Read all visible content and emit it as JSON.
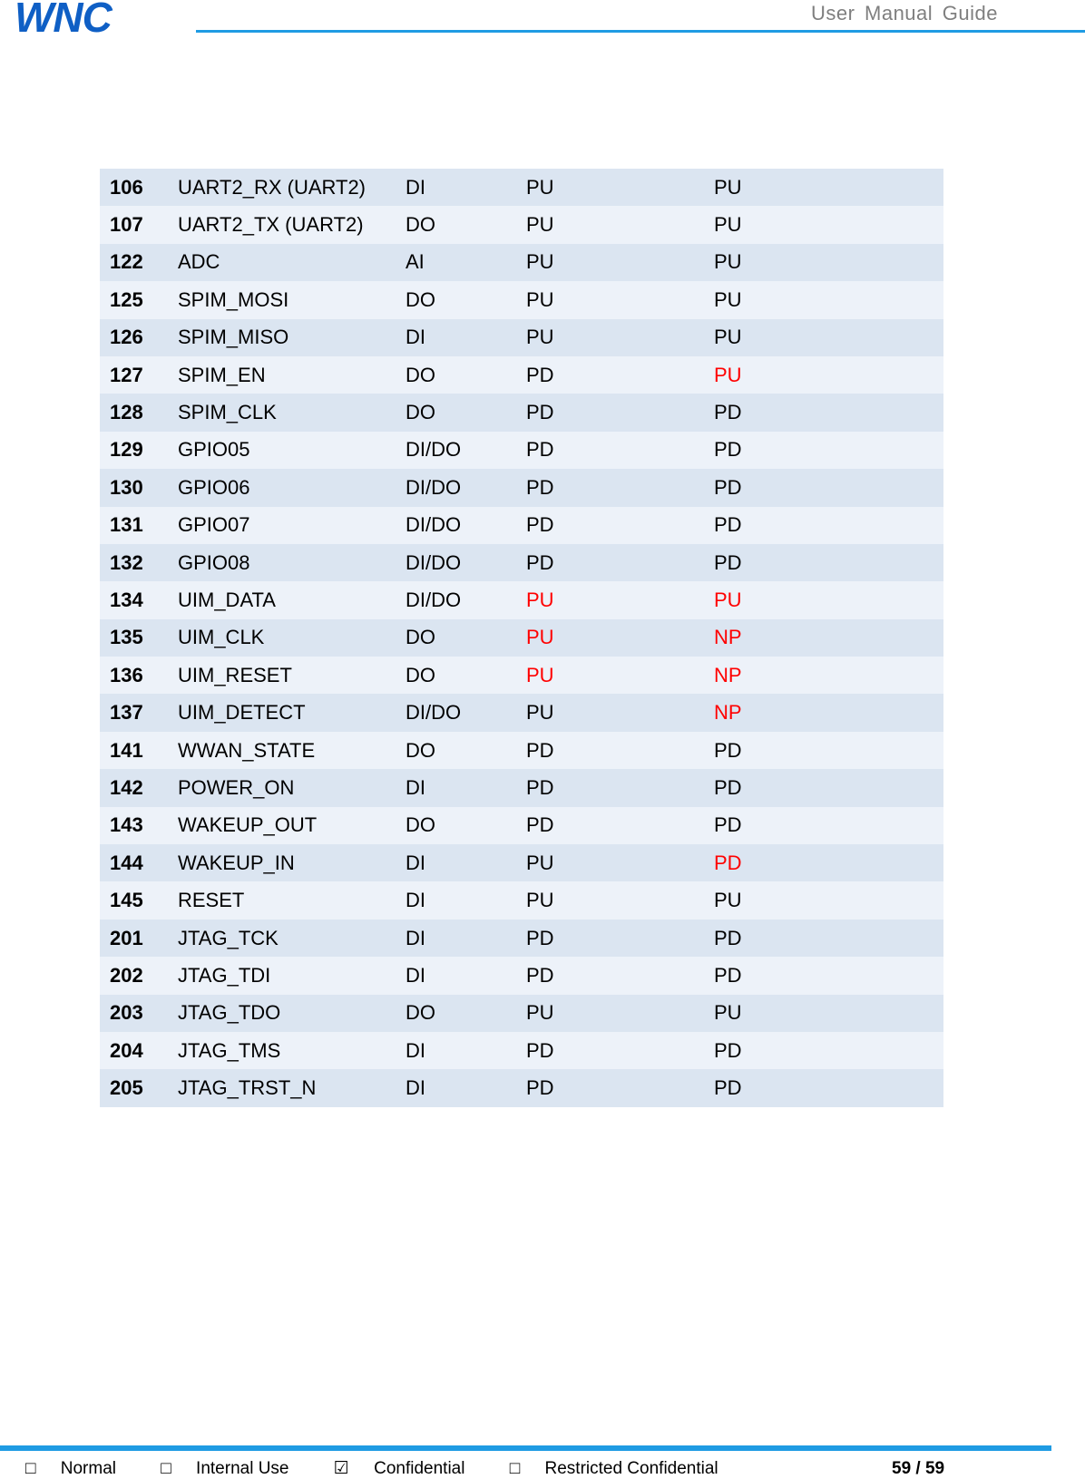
{
  "header": {
    "logo_text": "WNC",
    "brand_color": "#0f5fc5",
    "accent_color": "#1f9be3",
    "title": "User  Manual  Guide"
  },
  "table": {
    "rows": [
      {
        "pin": "106",
        "name": "UART2_RX (UART2)",
        "type": "DI",
        "state1": "PU",
        "state2": "PU",
        "state1_red": false,
        "state2_red": false
      },
      {
        "pin": "107",
        "name": "UART2_TX (UART2)",
        "type": "DO",
        "state1": "PU",
        "state2": "PU",
        "state1_red": false,
        "state2_red": false
      },
      {
        "pin": "122",
        "name": "ADC",
        "type": "AI",
        "state1": "PU",
        "state2": "PU",
        "state1_red": false,
        "state2_red": false
      },
      {
        "pin": "125",
        "name": "SPIM_MOSI",
        "type": "DO",
        "state1": "PU",
        "state2": "PU",
        "state1_red": false,
        "state2_red": false
      },
      {
        "pin": "126",
        "name": "SPIM_MISO",
        "type": "DI",
        "state1": "PU",
        "state2": "PU",
        "state1_red": false,
        "state2_red": false
      },
      {
        "pin": "127",
        "name": "SPIM_EN",
        "type": "DO",
        "state1": "PD",
        "state2": "PU",
        "state1_red": false,
        "state2_red": true
      },
      {
        "pin": "128",
        "name": "SPIM_CLK",
        "type": "DO",
        "state1": "PD",
        "state2": "PD",
        "state1_red": false,
        "state2_red": false
      },
      {
        "pin": "129",
        "name": "GPIO05",
        "type": "DI/DO",
        "state1": "PD",
        "state2": "PD",
        "state1_red": false,
        "state2_red": false
      },
      {
        "pin": "130",
        "name": "GPIO06",
        "type": "DI/DO",
        "state1": "PD",
        "state2": "PD",
        "state1_red": false,
        "state2_red": false
      },
      {
        "pin": "131",
        "name": "GPIO07",
        "type": "DI/DO",
        "state1": "PD",
        "state2": "PD",
        "state1_red": false,
        "state2_red": false
      },
      {
        "pin": "132",
        "name": "GPIO08",
        "type": "DI/DO",
        "state1": "PD",
        "state2": "PD",
        "state1_red": false,
        "state2_red": false
      },
      {
        "pin": "134",
        "name": "UIM_DATA",
        "type": "DI/DO",
        "state1": "PU",
        "state2": "PU",
        "state1_red": true,
        "state2_red": true
      },
      {
        "pin": "135",
        "name": "UIM_CLK",
        "type": "DO",
        "state1": "PU",
        "state2": "NP",
        "state1_red": true,
        "state2_red": true
      },
      {
        "pin": "136",
        "name": "UIM_RESET",
        "type": "DO",
        "state1": "PU",
        "state2": "NP",
        "state1_red": true,
        "state2_red": true
      },
      {
        "pin": "137",
        "name": "UIM_DETECT",
        "type": "DI/DO",
        "state1": "PU",
        "state2": "NP",
        "state1_red": false,
        "state2_red": true
      },
      {
        "pin": "141",
        "name": "WWAN_STATE",
        "type": "DO",
        "state1": "PD",
        "state2": "PD",
        "state1_red": false,
        "state2_red": false
      },
      {
        "pin": "142",
        "name": "POWER_ON",
        "type": "DI",
        "state1": "PD",
        "state2": "PD",
        "state1_red": false,
        "state2_red": false
      },
      {
        "pin": "143",
        "name": "WAKEUP_OUT",
        "type": "DO",
        "state1": "PD",
        "state2": "PD",
        "state1_red": false,
        "state2_red": false
      },
      {
        "pin": "144",
        "name": "WAKEUP_IN",
        "type": "DI",
        "state1": "PU",
        "state2": "PD",
        "state1_red": false,
        "state2_red": true
      },
      {
        "pin": "145",
        "name": "RESET",
        "type": "DI",
        "state1": "PU",
        "state2": "PU",
        "state1_red": false,
        "state2_red": false
      },
      {
        "pin": "201",
        "name": "JTAG_TCK",
        "type": "DI",
        "state1": "PD",
        "state2": "PD",
        "state1_red": false,
        "state2_red": false
      },
      {
        "pin": "202",
        "name": "JTAG_TDI",
        "type": "DI",
        "state1": "PD",
        "state2": "PD",
        "state1_red": false,
        "state2_red": false
      },
      {
        "pin": "203",
        "name": "JTAG_TDO",
        "type": "DO",
        "state1": "PU",
        "state2": "PU",
        "state1_red": false,
        "state2_red": false
      },
      {
        "pin": "204",
        "name": "JTAG_TMS",
        "type": "DI",
        "state1": "PD",
        "state2": "PD",
        "state1_red": false,
        "state2_red": false
      },
      {
        "pin": "205",
        "name": "JTAG_TRST_N",
        "type": "DI",
        "state1": "PD",
        "state2": "PD",
        "state1_red": false,
        "state2_red": false
      }
    ],
    "row_colors": {
      "odd": "#dbe5f1",
      "even": "#edf2f9"
    },
    "highlight_color": "#ff0000"
  },
  "footer": {
    "classifications": [
      {
        "box": "□",
        "label": "Normal",
        "checked": false
      },
      {
        "box": "□",
        "label": "Internal Use",
        "checked": false
      },
      {
        "box": "☑",
        "label": "Confidential",
        "checked": true
      },
      {
        "box": "□",
        "label": "Restricted Confidential",
        "checked": false
      }
    ],
    "page": "59 / 59"
  }
}
